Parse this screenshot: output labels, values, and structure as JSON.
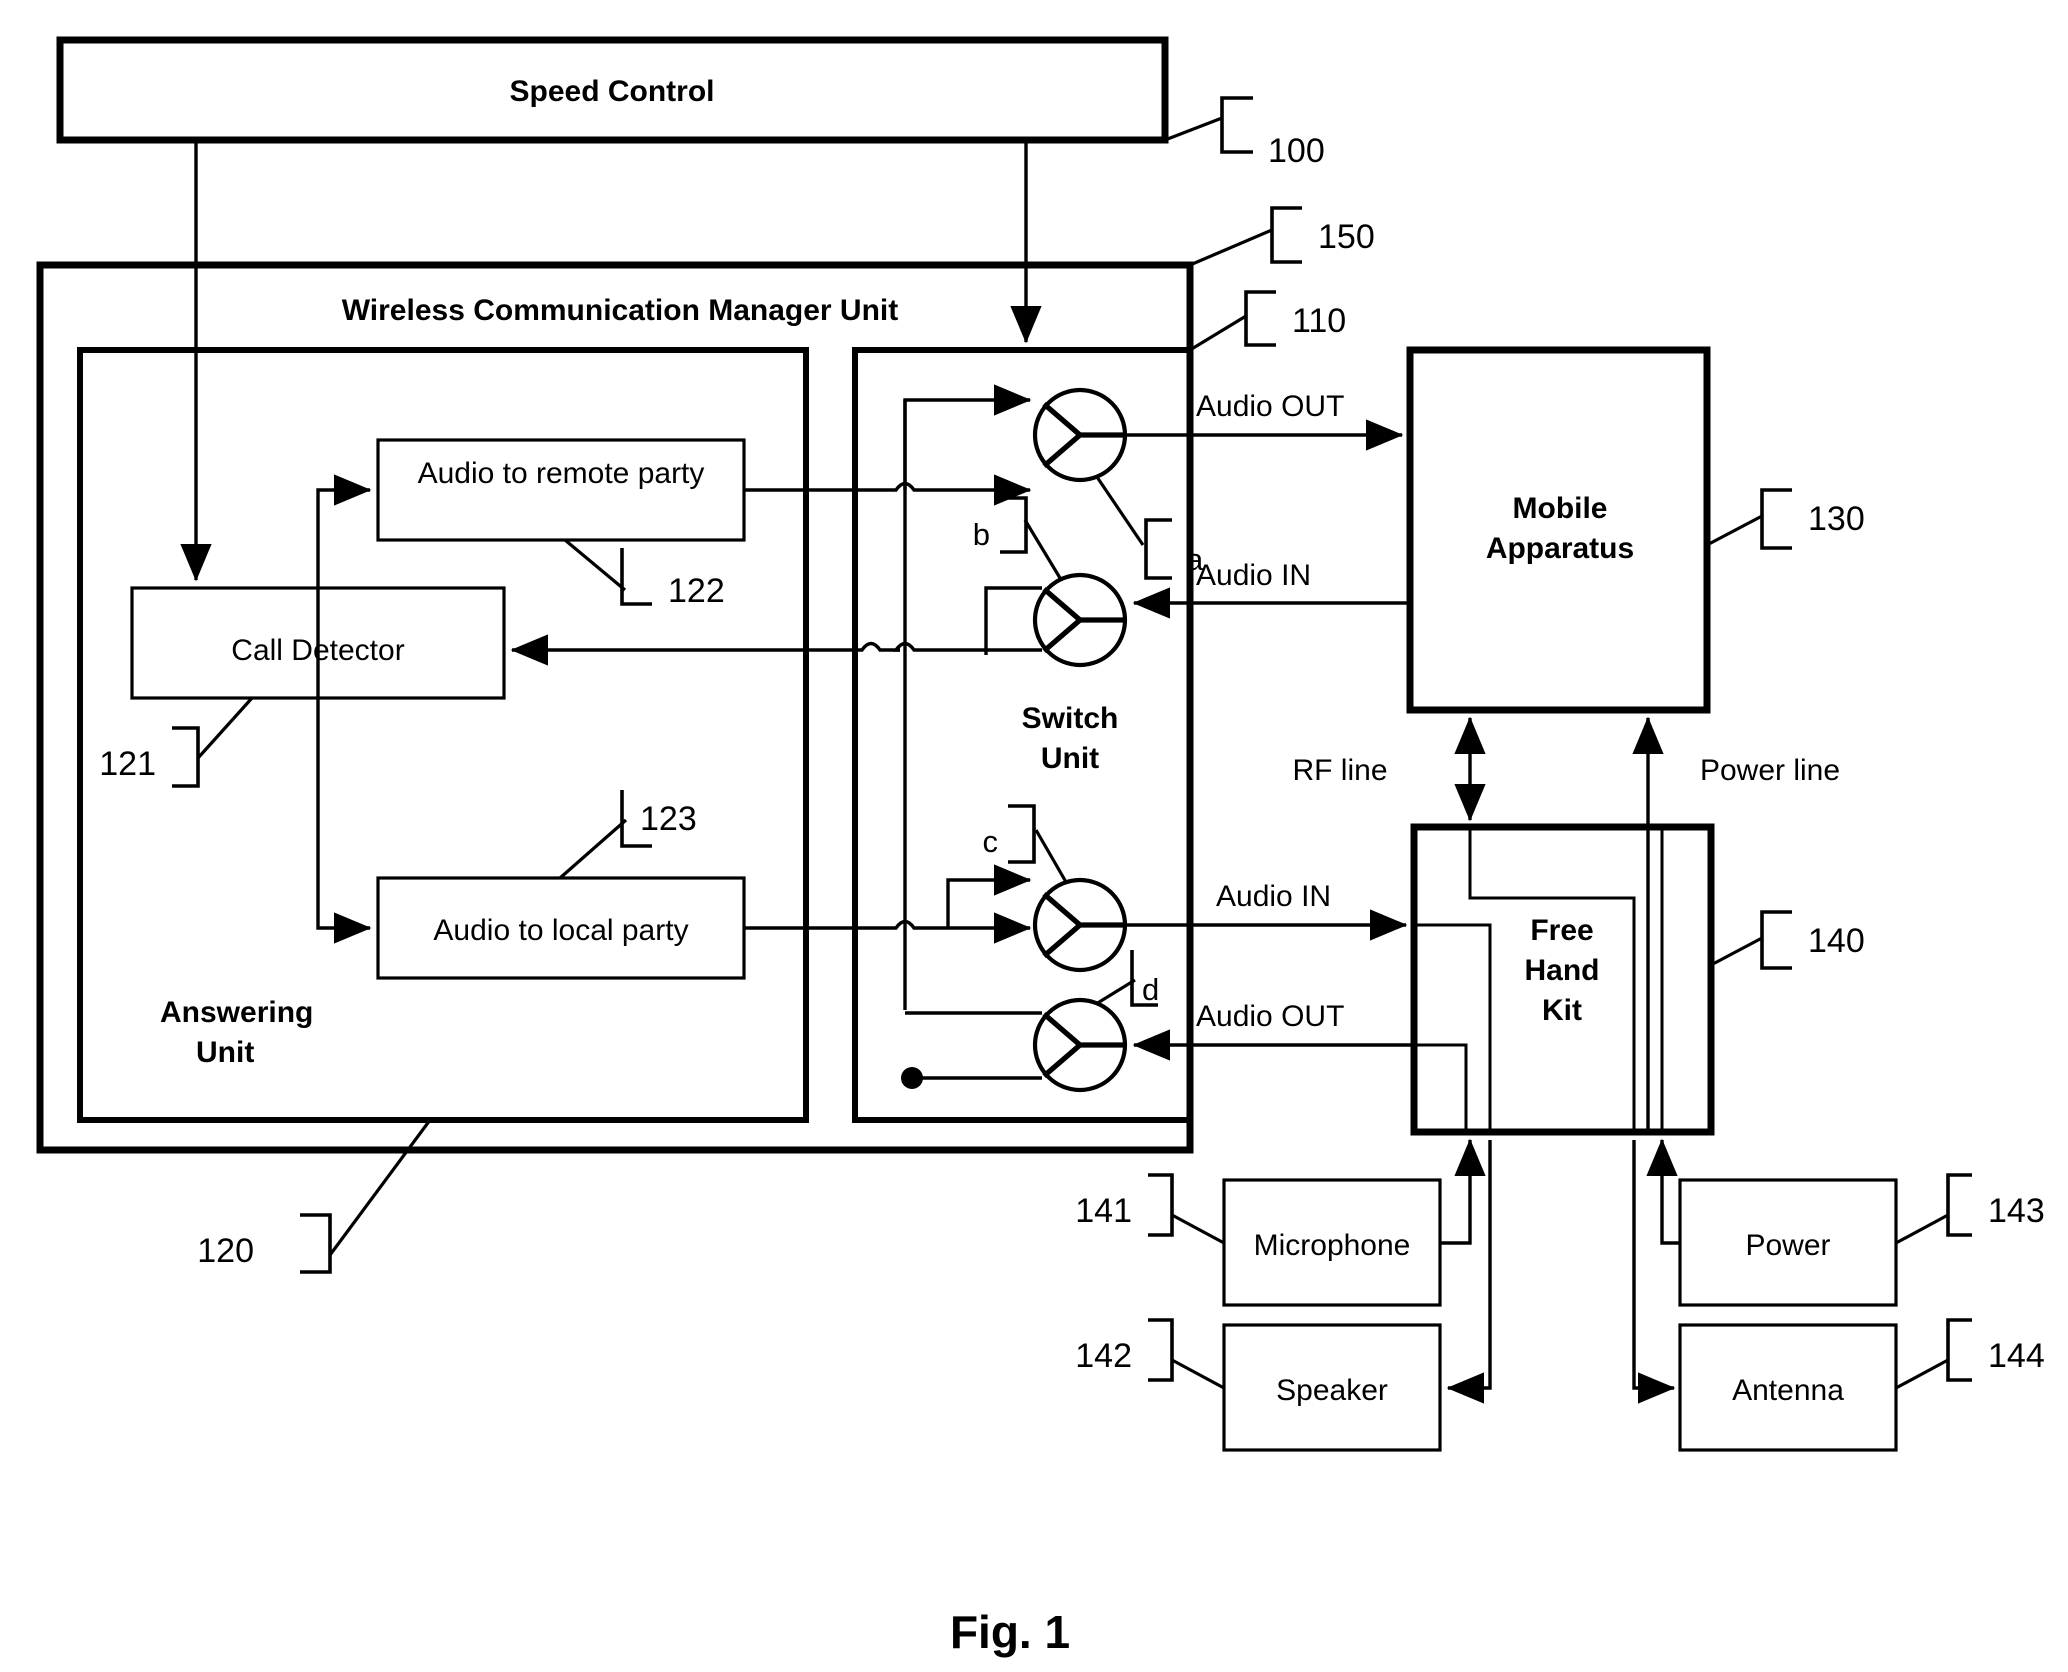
{
  "figure": {
    "caption": "Fig. 1"
  },
  "blocks": {
    "speed_control": "Speed Control",
    "wcmu": "Wireless Communication Manager Unit",
    "answering_unit": "Answering\nUnit",
    "answering_unit_line1": "Answering",
    "answering_unit_line2": "Unit",
    "switch_unit_line1": "Switch",
    "switch_unit_line2": "Unit",
    "audio_to_remote": "Audio to remote party",
    "audio_to_local": "Audio to local party",
    "call_detector": "Call Detector",
    "mobile_apparatus_line1": "Mobile",
    "mobile_apparatus_line2": "Apparatus",
    "free_hand_kit_line1": "Free",
    "free_hand_kit_line2": "Hand",
    "free_hand_kit_line3": "Kit",
    "microphone": "Microphone",
    "speaker": "Speaker",
    "power": "Power",
    "antenna": "Antenna"
  },
  "signal_labels": {
    "audio_out_top": "Audio OUT",
    "audio_in_top": "Audio IN",
    "audio_in_bottom": "Audio IN",
    "audio_out_bottom": "Audio OUT",
    "rf_line": "RF line",
    "power_line": "Power line"
  },
  "switch_labels": {
    "a": "a",
    "b": "b",
    "c": "c",
    "d": "d"
  },
  "reference_numbers": {
    "speed_control": "100",
    "switch_unit": "110",
    "answering_unit": "120",
    "call_detector": "121",
    "audio_to_remote": "122",
    "audio_to_local": "123",
    "mobile_apparatus": "130",
    "free_hand_kit": "140",
    "microphone": "141",
    "speaker": "142",
    "power": "143",
    "antenna": "144",
    "wcmu": "150"
  },
  "colors": {
    "stroke": "#000000",
    "background": "#ffffff"
  }
}
